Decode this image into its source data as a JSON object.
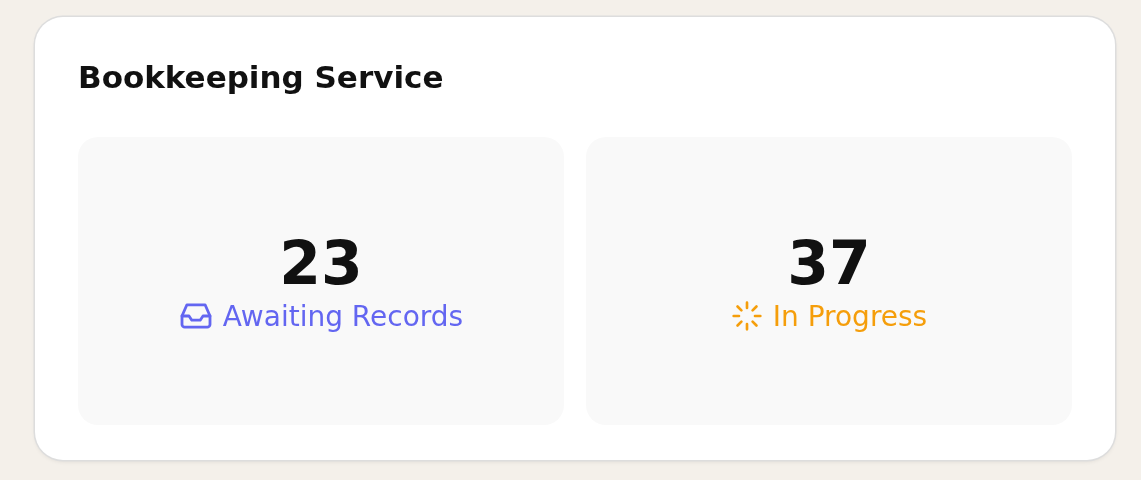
{
  "card": {
    "title": "Bookkeeping Service"
  },
  "stats": [
    {
      "value": "23",
      "label": "Awaiting Records",
      "kind": "inbox",
      "color": "#6366f1"
    },
    {
      "value": "37",
      "label": "In Progress",
      "kind": "loader",
      "color": "#f59e0b"
    }
  ]
}
